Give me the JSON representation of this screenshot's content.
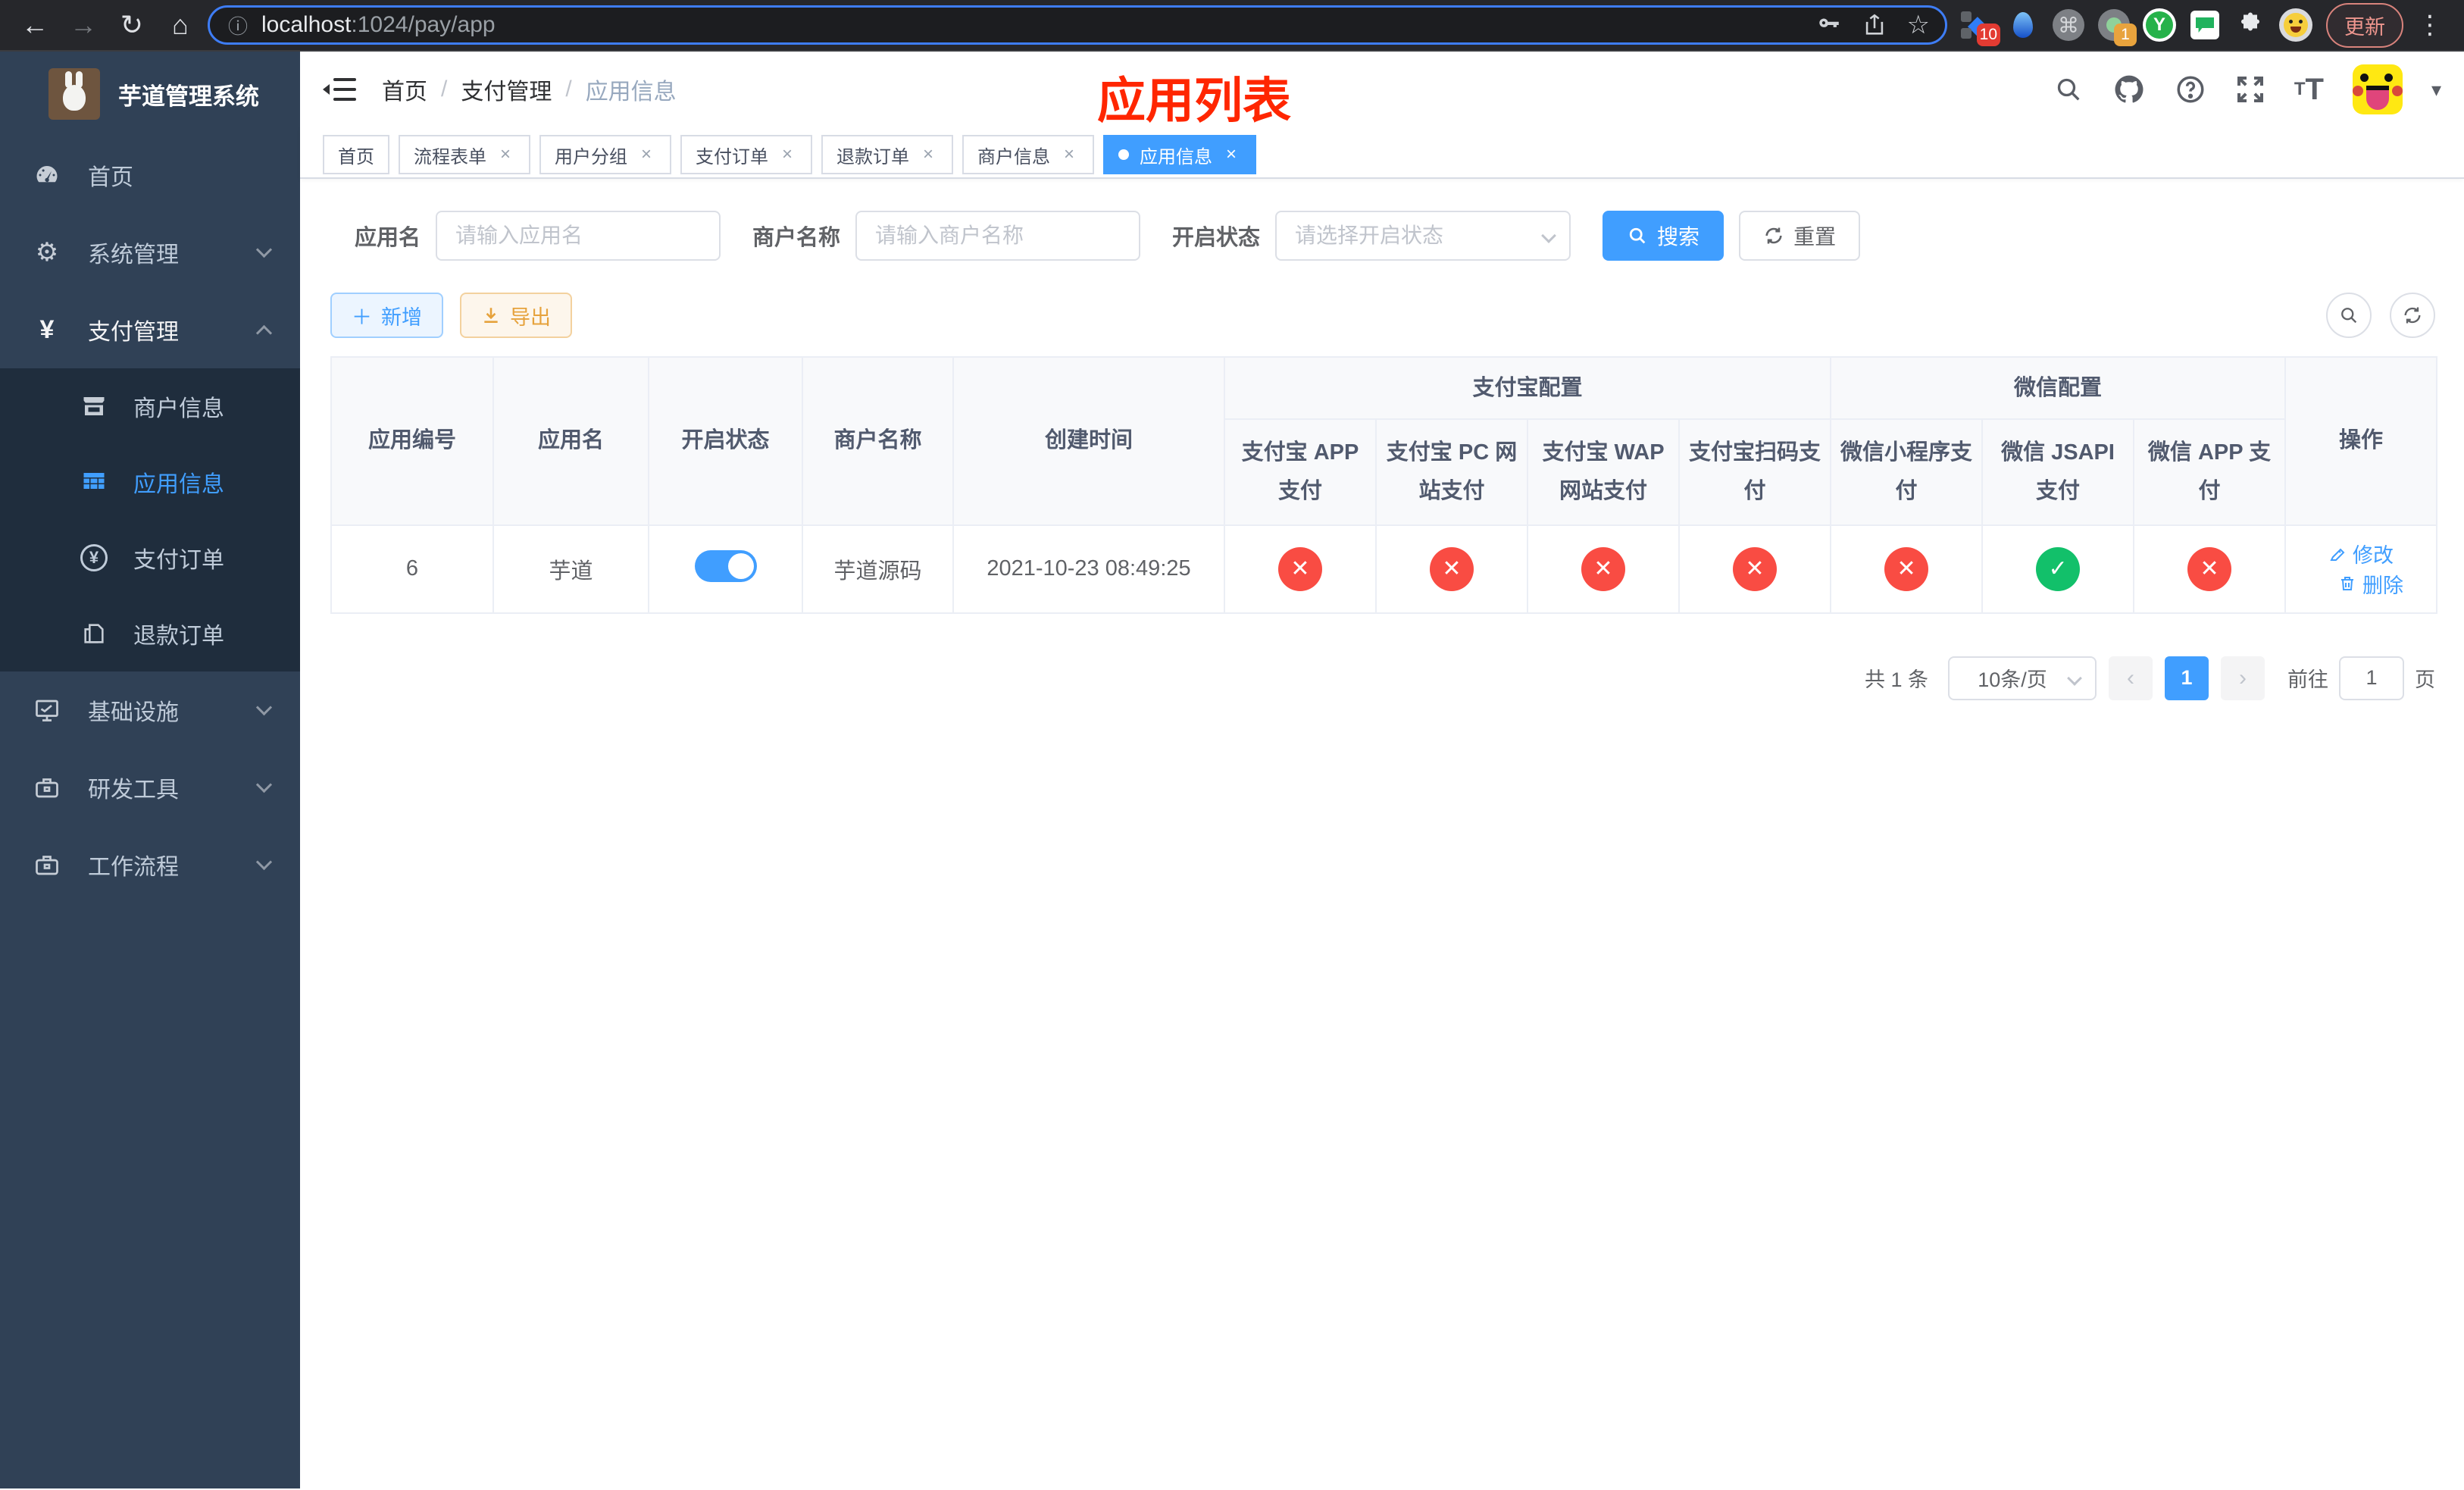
{
  "browser": {
    "url_host": "localhost",
    "url_path": ":1024/pay/app",
    "update_label": "更新",
    "ext_badge_blue_diamond": "10",
    "ext_badge_gray_dot": "1",
    "menu_glyph": "⋮",
    "back_glyph": "←",
    "forward_glyph": "→",
    "reload_glyph": "↻",
    "home_glyph": "⌂",
    "info_glyph": "ⓘ",
    "star_glyph": "☆",
    "command_glyph": "⌘"
  },
  "sidebar": {
    "title": "芋道管理系统",
    "menu": [
      {
        "label": "首页"
      },
      {
        "label": "系统管理"
      },
      {
        "label": "支付管理"
      }
    ],
    "submenu": [
      {
        "label": "商户信息"
      },
      {
        "label": "应用信息"
      },
      {
        "label": "支付订单"
      },
      {
        "label": "退款订单"
      }
    ],
    "bottom_menu": [
      {
        "label": "基础设施"
      },
      {
        "label": "研发工具"
      },
      {
        "label": "工作流程"
      }
    ],
    "yen_glyph": "¥",
    "gear_glyph": "⚙"
  },
  "header": {
    "breadcrumb": [
      {
        "label": "首页"
      },
      {
        "label": "支付管理"
      },
      {
        "label": "应用信息"
      }
    ],
    "separator": "/",
    "annotation": "应用列表"
  },
  "tabs": [
    {
      "label": "首页"
    },
    {
      "label": "流程表单"
    },
    {
      "label": "用户分组"
    },
    {
      "label": "支付订单"
    },
    {
      "label": "退款订单"
    },
    {
      "label": "商户信息"
    },
    {
      "label": "应用信息"
    }
  ],
  "filters": {
    "app_name_label": "应用名",
    "app_name_placeholder": "请输入应用名",
    "merchant_label": "商户名称",
    "merchant_placeholder": "请输入商户名称",
    "status_label": "开启状态",
    "status_placeholder": "请选择开启状态",
    "search_label": "搜索",
    "reset_label": "重置"
  },
  "toolbar": {
    "add_label": "新增",
    "export_label": "导出"
  },
  "table": {
    "group_alipay": "支付宝配置",
    "group_wechat": "微信配置",
    "col_id": "应用编号",
    "col_name": "应用名",
    "col_status": "开启状态",
    "col_merchant": "商户名称",
    "col_created": "创建时间",
    "col_op": "操作",
    "pay_columns": [
      "支付宝 APP 支付",
      "支付宝 PC 网站支付",
      "支付宝 WAP 网站支付",
      "支付宝扫码支付",
      "微信小程序支付",
      "微信 JSAPI 支付",
      "微信 APP 支付"
    ],
    "row": {
      "id": "6",
      "name": "芋道",
      "enabled": true,
      "merchant": "芋道源码",
      "created": "2021-10-23 08:49:25",
      "pay_status": [
        false,
        false,
        false,
        false,
        false,
        true,
        false
      ],
      "edit_label": "修改",
      "delete_label": "删除"
    },
    "glyph_ok": "✓",
    "glyph_fail": "✕"
  },
  "pagination": {
    "total": "共 1 条",
    "page_size": "10条/页",
    "prev_glyph": "‹",
    "next_glyph": "›",
    "page": "1",
    "goto_label": "前往",
    "goto_value": "1",
    "goto_unit": "页"
  },
  "colors": {
    "primary": "#409eff",
    "danger": "#f94c43",
    "success": "#12c06a",
    "warning": "#e6a23c",
    "sidebar_bg": "#304156",
    "submenu_bg": "#1f2d3d",
    "annotation_red": "#ff2600"
  }
}
